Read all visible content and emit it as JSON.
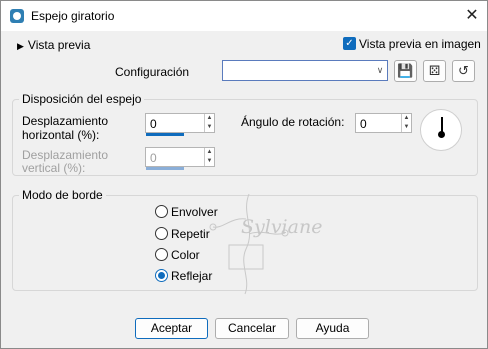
{
  "window": {
    "title": "Espejo giratorio",
    "icon": "app-icon",
    "close_glyph": "✕"
  },
  "preview": {
    "toggle_label": "Vista previa",
    "toggle_glyph": "▶",
    "checkbox_label": "Vista previa en imagen",
    "checkbox_checked": true
  },
  "config": {
    "label": "Configuración",
    "value": "",
    "dropdown_glyph": "∨",
    "tools": [
      {
        "icon": "save-icon",
        "glyph": "💾"
      },
      {
        "icon": "random-icon",
        "glyph": "⚄"
      },
      {
        "icon": "reset-icon",
        "glyph": "↺"
      }
    ]
  },
  "mirror": {
    "title": "Disposición del espejo",
    "h_offset_label_1": "Desplazamiento",
    "h_offset_label_2": "horizontal (%):",
    "h_offset_value": "0",
    "v_offset_label_1": "Desplazamiento",
    "v_offset_label_2": "vertical (%):",
    "v_offset_value": "0",
    "rotation_label": "Ángulo de rotación:",
    "rotation_value": "0"
  },
  "border": {
    "title": "Modo de borde",
    "options": [
      {
        "label": "Envolver",
        "selected": false
      },
      {
        "label": "Repetir",
        "selected": false
      },
      {
        "label": "Color",
        "selected": false
      },
      {
        "label": "Reflejar",
        "selected": true
      }
    ]
  },
  "watermark": "Sylviane",
  "buttons": {
    "ok": "Aceptar",
    "cancel": "Cancelar",
    "help": "Ayuda"
  },
  "colors": {
    "accent": "#0f6cbd",
    "window_bg": "#f0f0f0"
  }
}
